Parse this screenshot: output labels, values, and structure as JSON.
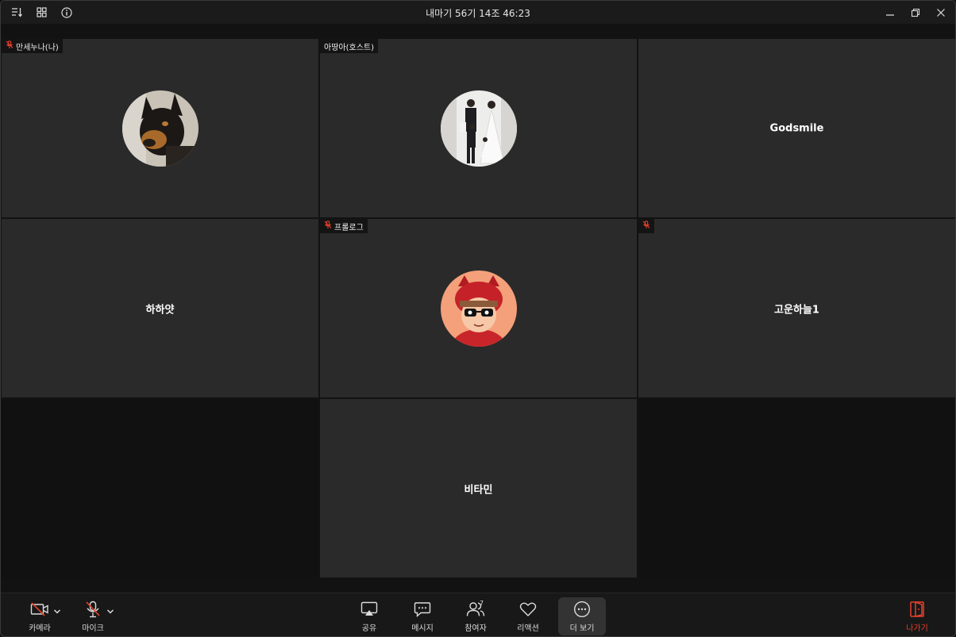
{
  "window": {
    "title": "내마기 56기 14조 46:23",
    "left_icons": [
      "sort-icon",
      "grid-view-icon",
      "info-icon"
    ],
    "right_icons": [
      "minimize-icon",
      "restore-icon",
      "close-icon"
    ]
  },
  "participants": [
    {
      "label": "만세누나(나)",
      "muted": true,
      "display": "avatar",
      "avatar": "dog-photo",
      "big_name": ""
    },
    {
      "label": "아땅아(호스트)",
      "muted": false,
      "display": "avatar",
      "avatar": "family-photo",
      "big_name": ""
    },
    {
      "label": "",
      "muted": false,
      "display": "name",
      "big_name": "Godsmile"
    },
    {
      "label": "",
      "muted": false,
      "display": "name",
      "big_name": "하하얏"
    },
    {
      "label": "프롤로그",
      "muted": true,
      "display": "avatar",
      "avatar": "cartoon-character",
      "big_name": ""
    },
    {
      "label": "",
      "muted": true,
      "display": "name",
      "big_name": "고운하늘1"
    },
    {
      "label": "",
      "muted": false,
      "display": "name",
      "big_name": "비타민"
    }
  ],
  "toolbar": {
    "camera_label": "카메라",
    "mic_label": "마이크",
    "share_label": "공유",
    "message_label": "메시지",
    "participants_label": "참여자",
    "participants_count": "7",
    "reaction_label": "리액션",
    "more_label": "더 보기",
    "leave_label": "나가기"
  },
  "colors": {
    "accent_red": "#e8412c",
    "tile_bg": "#2a2a2a",
    "background": "#111111"
  }
}
